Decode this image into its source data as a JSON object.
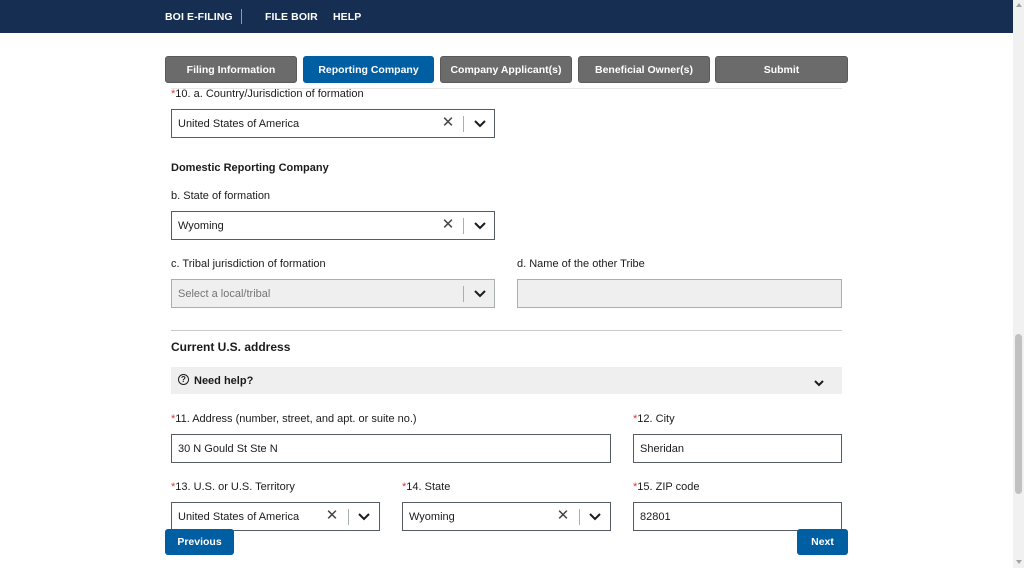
{
  "nav": {
    "boi_efiling": "BOI E-FILING",
    "file_boir": "FILE BOIR",
    "help": "HELP"
  },
  "steps": [
    {
      "label": "Filing Information",
      "active": false
    },
    {
      "label": "Reporting Company",
      "active": true
    },
    {
      "label": "Company Applicant(s)",
      "active": false
    },
    {
      "label": "Beneficial Owner(s)",
      "active": false
    },
    {
      "label": "Submit",
      "active": false
    }
  ],
  "form": {
    "country": {
      "label": "10. a. Country/Jurisdiction of formation",
      "required_mark": "*",
      "value": "United States of America"
    },
    "domestic_heading": "Domestic Reporting Company",
    "state_formation": {
      "label": "b. State of formation",
      "value": "Wyoming"
    },
    "tribal": {
      "label": "c. Tribal jurisdiction of formation",
      "placeholder": "Select a local/tribal"
    },
    "other_tribe": {
      "label": "d. Name of the other Tribe",
      "value": ""
    },
    "address_heading": "Current U.S. address",
    "need_help": "Need help?",
    "address": {
      "label": "11. Address (number, street, and apt. or suite no.)",
      "required_mark": "*",
      "value": "30 N Gould St Ste N"
    },
    "city": {
      "label": "12. City",
      "required_mark": "*",
      "value": "Sheridan"
    },
    "territory": {
      "label": "13. U.S. or U.S. Territory",
      "required_mark": "*",
      "value": "United States of America"
    },
    "state": {
      "label": "14. State",
      "required_mark": "*",
      "value": "Wyoming"
    },
    "zip": {
      "label": "15. ZIP code",
      "required_mark": "*",
      "value": "82801"
    }
  },
  "buttons": {
    "previous": "Previous",
    "next": "Next"
  },
  "colors": {
    "header_bg": "#162e51",
    "primary": "#005ea2",
    "inactive_step": "#6b6b6b",
    "required": "#d83933"
  }
}
